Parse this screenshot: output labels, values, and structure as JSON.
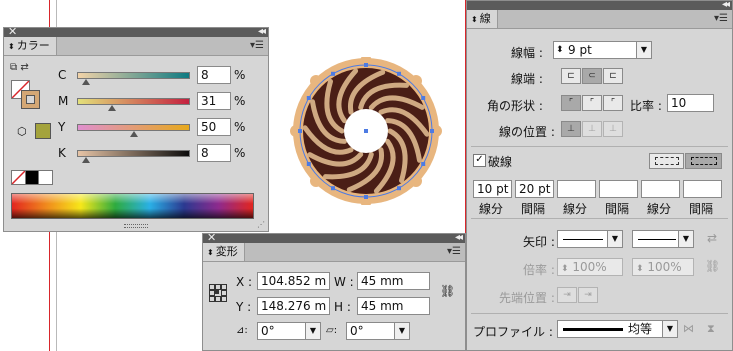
{
  "color_panel": {
    "tab": "カラー",
    "channels": [
      {
        "label": "C",
        "value": "8",
        "unit": "%",
        "fraction": 0.08
      },
      {
        "label": "M",
        "value": "31",
        "unit": "%",
        "fraction": 0.31
      },
      {
        "label": "Y",
        "value": "50",
        "unit": "%",
        "fraction": 0.5
      },
      {
        "label": "K",
        "value": "8",
        "unit": "%",
        "fraction": 0.08
      }
    ],
    "swatch_color": "#a4a33c",
    "fill_color": "#d3a775"
  },
  "transform_panel": {
    "tab": "変形",
    "x_label": "X :",
    "x_value": "104.852 m",
    "y_label": "Y :",
    "y_value": "148.276 m",
    "w_label": "W :",
    "w_value": "45 mm",
    "h_label": "H :",
    "h_value": "45 mm",
    "rotate_value": "0°",
    "shear_value": "0°"
  },
  "stroke_panel": {
    "tab": "線",
    "weight_label": "線幅 :",
    "weight_value": "9 pt",
    "cap_label": "線端 :",
    "join_label": "角の形状 :",
    "limit_label": "比率 :",
    "limit_value": "10",
    "align_label": "線の位置 :",
    "dashed_label": "破線",
    "dash_values": [
      "10 pt",
      "20 pt",
      "",
      "",
      "",
      ""
    ],
    "dash_labels": [
      "線分",
      "間隔",
      "線分",
      "間隔",
      "線分",
      "間隔"
    ],
    "arrow_label": "矢印 :",
    "scale_label": "倍率 :",
    "scale_start": "100%",
    "scale_end": "100%",
    "tip_label": "先端位置 :",
    "profile_label": "プロファイル :",
    "profile_value": "均等"
  },
  "artwork": {
    "outer_color": "#e8b67f",
    "inner_color": "#4a1e16",
    "swirl_color": "#cfa982"
  }
}
